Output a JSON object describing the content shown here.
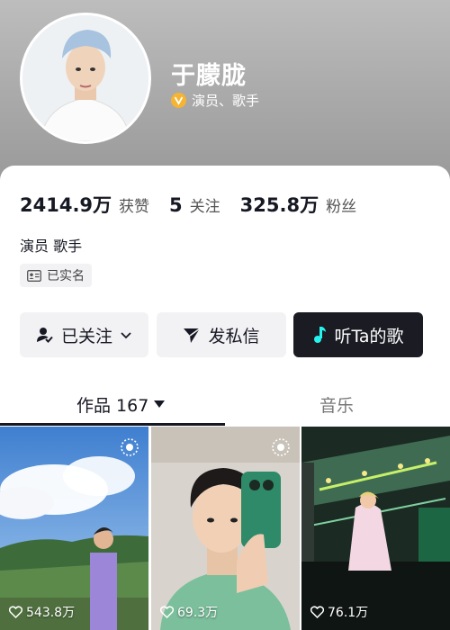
{
  "profile": {
    "name": "于朦胧",
    "verify_text": "演员、歌手",
    "verify_badge_color": "#f5b431",
    "avatar_icon": "avatar-photo"
  },
  "stats": [
    {
      "value": "2414.9万",
      "label": "获赞"
    },
    {
      "value": "5",
      "label": "关注"
    },
    {
      "value": "325.8万",
      "label": "粉丝"
    }
  ],
  "bio": "演员 歌手",
  "real_name_badge": "已实名",
  "buttons": {
    "follow": "已关注",
    "message": "发私信",
    "music": "听Ta的歌"
  },
  "tabs": {
    "works": "作品 167",
    "music": "音乐"
  },
  "videos": [
    {
      "likes": "543.8万"
    },
    {
      "likes": "69.3万"
    },
    {
      "likes": "76.1万"
    }
  ],
  "colors": {
    "primary_dark": "#1b1c23",
    "music_note": "#25f4ee"
  }
}
